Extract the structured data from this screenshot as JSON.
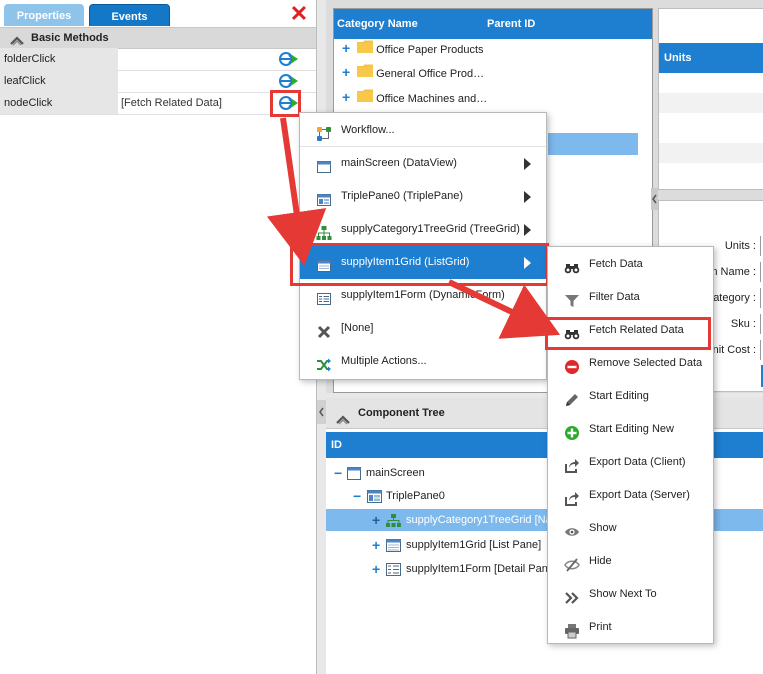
{
  "tabs": {
    "properties": "Properties",
    "events": "Events"
  },
  "close_glyph": "✕",
  "group_header": "Basic Methods",
  "props": [
    {
      "label": "folderClick",
      "value": ""
    },
    {
      "label": "leafClick",
      "value": ""
    },
    {
      "label": "nodeClick",
      "value": "[Fetch Related Data]"
    }
  ],
  "grid": {
    "columns": [
      "Category Name",
      "Parent ID"
    ],
    "rows": [
      "Office Paper Products",
      "General Office Prod…",
      "Office Machines and…"
    ]
  },
  "units_header": "Units",
  "form_labels": [
    "Units :",
    "m Name :",
    "ategory :",
    "Sku :",
    "nit Cost :"
  ],
  "tree": {
    "title": "Component Tree",
    "header": "ID",
    "rows": [
      {
        "label": "mainScreen"
      },
      {
        "label": "TriplePane0"
      },
      {
        "label": "supplyCategory1TreeGrid [Na"
      },
      {
        "label": "supplyItem1Grid [List Pane]"
      },
      {
        "label": "supplyItem1Form [Detail Pan"
      }
    ]
  },
  "menu1": [
    {
      "label": "Workflow...",
      "icon": "workflow-icon"
    },
    {
      "label": "mainScreen (DataView)",
      "icon": "window-icon"
    },
    {
      "label": "TriplePane0 (TriplePane)",
      "icon": "triplepane-icon"
    },
    {
      "label": "supplyCategory1TreeGrid (TreeGrid)",
      "icon": "treegrid-icon"
    },
    {
      "label": "supplyItem1Grid (ListGrid)",
      "icon": "listgrid-icon"
    },
    {
      "label": "supplyItem1Form (DynamicForm)",
      "icon": "form-icon"
    },
    {
      "label": "[None]",
      "icon": "x-icon"
    },
    {
      "label": "Multiple Actions...",
      "icon": "shuffle-icon"
    }
  ],
  "menu2": [
    {
      "label": "Fetch Data",
      "icon": "binoculars-icon"
    },
    {
      "label": "Filter Data",
      "icon": "funnel-icon"
    },
    {
      "label": "Fetch Related Data",
      "icon": "binoculars-icon"
    },
    {
      "label": "Remove Selected Data",
      "icon": "remove-icon"
    },
    {
      "label": "Start Editing",
      "icon": "pencil-icon"
    },
    {
      "label": "Start Editing New",
      "icon": "plus-circle-icon"
    },
    {
      "label": "Export Data (Client)",
      "icon": "export-icon"
    },
    {
      "label": "Export Data (Server)",
      "icon": "export-icon"
    },
    {
      "label": "Show",
      "icon": "eye-icon"
    },
    {
      "label": "Hide",
      "icon": "eye-slash-icon"
    },
    {
      "label": "Show Next To",
      "icon": "double-chevron-icon"
    },
    {
      "label": "Print",
      "icon": "printer-icon"
    }
  ],
  "colors": {
    "accent": "#1e7fd0",
    "highlight_box": "#e53935",
    "arrow": "#e53935"
  }
}
